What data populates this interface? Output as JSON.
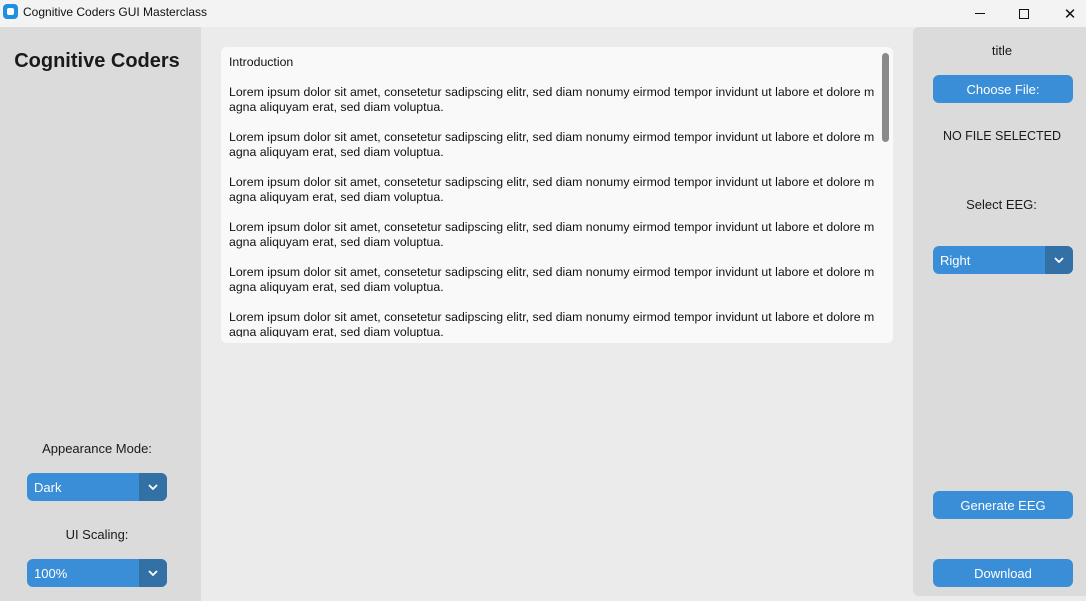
{
  "window": {
    "title": "Cognitive Coders GUI Masterclass",
    "minimize_glyph": "",
    "close_glyph": "✕"
  },
  "sidebar": {
    "logo": "Cognitive Coders",
    "appearance_label": "Appearance Mode:",
    "appearance_value": "Dark",
    "scaling_label": "UI Scaling:",
    "scaling_value": "100%"
  },
  "textbox": {
    "heading": "Introduction",
    "paragraphs": [
      "Lorem ipsum dolor sit amet, consetetur sadipscing elitr, sed diam nonumy eirmod tempor invidunt ut labore et dolore magna aliquyam erat, sed diam voluptua.",
      "Lorem ipsum dolor sit amet, consetetur sadipscing elitr, sed diam nonumy eirmod tempor invidunt ut labore et dolore magna aliquyam erat, sed diam voluptua.",
      "Lorem ipsum dolor sit amet, consetetur sadipscing elitr, sed diam nonumy eirmod tempor invidunt ut labore et dolore magna aliquyam erat, sed diam voluptua.",
      "Lorem ipsum dolor sit amet, consetetur sadipscing elitr, sed diam nonumy eirmod tempor invidunt ut labore et dolore magna aliquyam erat, sed diam voluptua.",
      "Lorem ipsum dolor sit amet, consetetur sadipscing elitr, sed diam nonumy eirmod tempor invidunt ut labore et dolore magna aliquyam erat, sed diam voluptua.",
      "Lorem ipsum dolor sit amet, consetetur sadipscing elitr, sed diam nonumy eirmod tempor invidunt ut labore et dolore magna aliquyam erat, sed diam voluptua."
    ]
  },
  "right_panel": {
    "title": "title",
    "choose_file_label": "Choose File:",
    "file_status": "NO FILE SELECTED",
    "select_eeg_label": "Select EEG:",
    "eeg_value": "Right",
    "generate_label": "Generate EEG",
    "download_label": "Download"
  },
  "icons": {
    "app": "app-icon",
    "dropdown": "chevron-down-icon"
  },
  "colors": {
    "accent": "#3a8ed8",
    "accent_dark": "#3270a6",
    "panel": "#dbdbdb",
    "background": "#ebebeb"
  }
}
